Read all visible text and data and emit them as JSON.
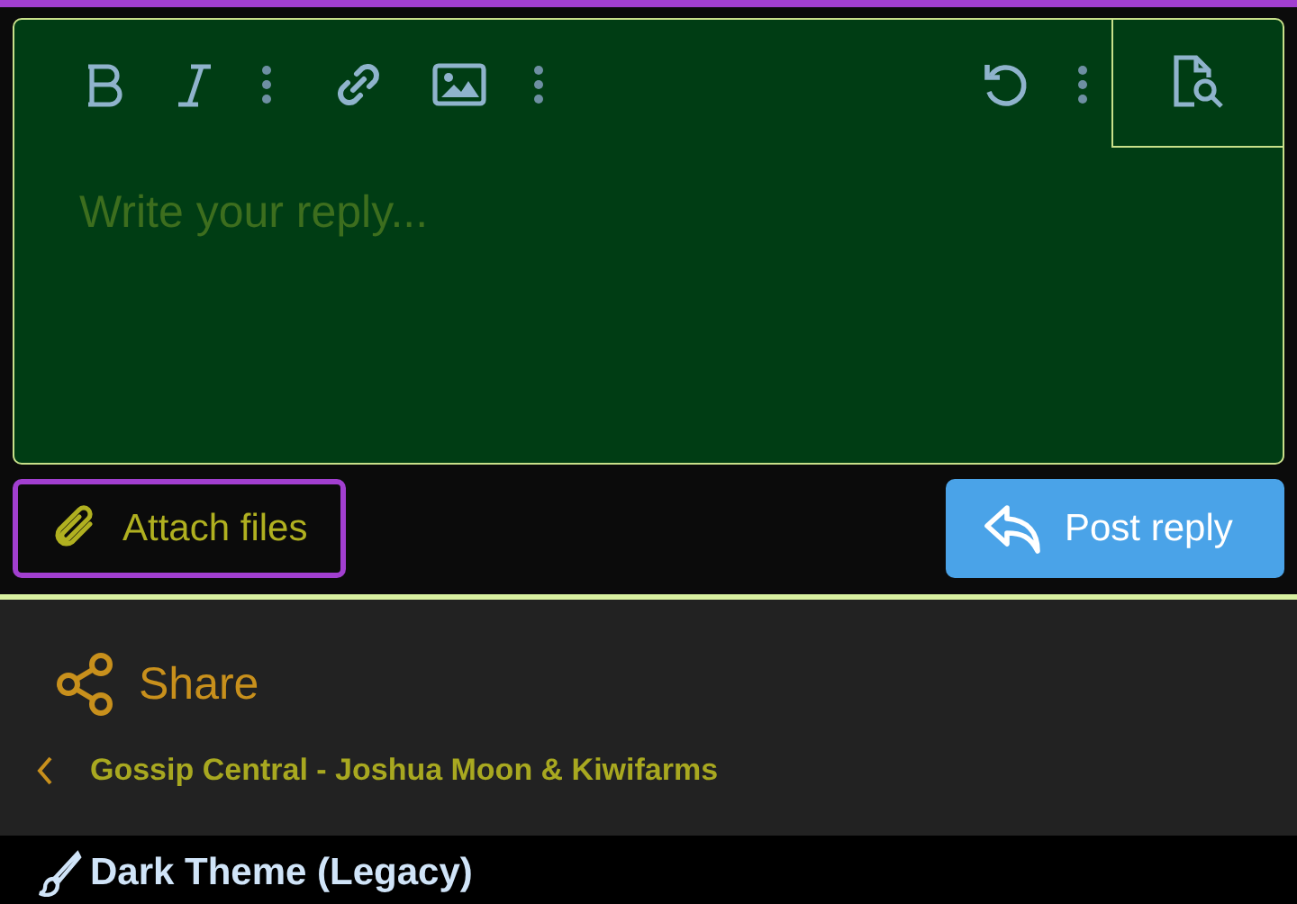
{
  "editor": {
    "placeholder": "Write your reply..."
  },
  "actions": [
    {
      "kind": "attach",
      "label": "Attach files"
    },
    {
      "kind": "post",
      "label": "Post reply"
    }
  ],
  "share": {
    "label": "Share"
  },
  "breadcrumb": {
    "label": "Gossip Central - Joshua Moon & Kiwifarms"
  },
  "footer": {
    "style_chooser": "Dark Theme (Legacy)"
  }
}
